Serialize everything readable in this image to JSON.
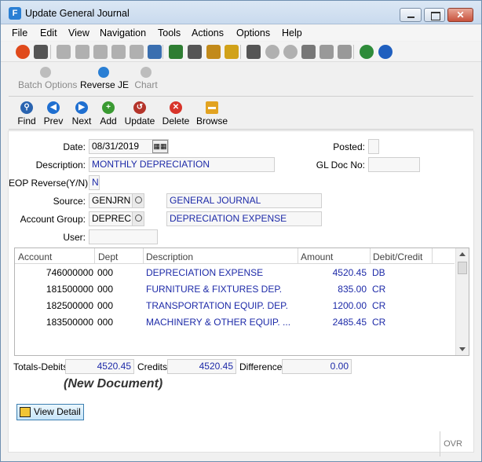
{
  "window": {
    "title": "Update General Journal"
  },
  "menu": [
    "File",
    "Edit",
    "View",
    "Navigation",
    "Tools",
    "Actions",
    "Options",
    "Help"
  ],
  "toolbar_icons": [
    {
      "name": "power-icon",
      "color": "#e04a1c"
    },
    {
      "name": "save-print-icon",
      "color": "#555555"
    },
    {
      "name": "check-icon",
      "color": "#b0b0b0"
    },
    {
      "name": "cancel-x-icon",
      "color": "#b0b0b0"
    },
    {
      "name": "copy-icon",
      "color": "#b0b0b0"
    },
    {
      "name": "paste-icon",
      "color": "#b0b0b0"
    },
    {
      "name": "select-icon",
      "color": "#b0b0b0"
    },
    {
      "name": "find-icon",
      "color": "#3a6fb0"
    },
    {
      "name": "notepad-icon",
      "color": "#2e7d32"
    },
    {
      "name": "document-icon",
      "color": "#555555"
    },
    {
      "name": "attach-icon",
      "color": "#c28a1a"
    },
    {
      "name": "calendar-icon",
      "color": "#d1a219"
    },
    {
      "name": "upload-icon",
      "color": "#555555"
    },
    {
      "name": "down-circle-icon",
      "color": "#b0b0b0"
    },
    {
      "name": "up-circle-icon",
      "color": "#b0b0b0"
    },
    {
      "name": "shuffle-icon",
      "color": "#777777"
    },
    {
      "name": "export-icon",
      "color": "#999999"
    },
    {
      "name": "delete-doc-icon",
      "color": "#999999"
    },
    {
      "name": "chart-trend-icon",
      "color": "#2e8b3a"
    },
    {
      "name": "help-icon",
      "color": "#1f5fbf"
    }
  ],
  "toolbar2": [
    {
      "label": "Batch Options",
      "enabled": false
    },
    {
      "label": "Reverse JE",
      "enabled": true
    },
    {
      "label": "Chart",
      "enabled": false
    }
  ],
  "toolbar3": [
    {
      "label": "Find",
      "color": "#2a64b0",
      "glyph": "⚲"
    },
    {
      "label": "Prev",
      "color": "#1f6fd0",
      "glyph": "◀"
    },
    {
      "label": "Next",
      "color": "#1f6fd0",
      "glyph": "▶"
    },
    {
      "label": "Add",
      "color": "#3a9a32",
      "glyph": "+"
    },
    {
      "label": "Update",
      "color": "#b4342a",
      "glyph": "↺"
    },
    {
      "label": "Delete",
      "color": "#d8342a",
      "glyph": "✕"
    },
    {
      "label": "Browse",
      "color": "#e2a321",
      "glyph": "▬"
    }
  ],
  "form": {
    "date_label": "Date:",
    "date_value": "08/31/2019",
    "posted_label": "Posted:",
    "posted_value": "",
    "description_label": "Description:",
    "description_value": "MONTHLY DEPRECIATION",
    "gl_doc_label": "GL Doc No:",
    "gl_doc_value": "",
    "eop_label": "EOP Reverse(Y/N):",
    "eop_value": "N",
    "source_label": "Source:",
    "source_code": "GENJRN",
    "source_desc": "GENERAL JOURNAL",
    "account_group_label": "Account Group:",
    "account_group_code": "DEPREC",
    "account_group_desc": "DEPRECIATION EXPENSE",
    "user_label": "User:",
    "user_value": ""
  },
  "grid": {
    "columns": [
      "Account",
      "Dept",
      "Description",
      "Amount",
      "Debit/Credit"
    ],
    "rows": [
      {
        "account": "746000000",
        "dept": "000",
        "description": "DEPRECIATION EXPENSE",
        "amount": "4520.45",
        "dc": "DB"
      },
      {
        "account": "181500000",
        "dept": "000",
        "description": "FURNITURE & FIXTURES DEP.",
        "amount": "835.00",
        "dc": "CR"
      },
      {
        "account": "182500000",
        "dept": "000",
        "description": "TRANSPORTATION EQUIP. DEP.",
        "amount": "1200.00",
        "dc": "CR"
      },
      {
        "account": "183500000",
        "dept": "000",
        "description": "MACHINERY & OTHER EQUIP. ...",
        "amount": "2485.45",
        "dc": "CR"
      }
    ]
  },
  "totals": {
    "debits_label": "Totals-Debits",
    "debits_value": "4520.45",
    "credits_label": "Credits",
    "credits_value": "4520.45",
    "difference_label": "Difference",
    "difference_value": "0.00"
  },
  "new_document": "(New Document)",
  "view_detail_label": "View Detail",
  "status": {
    "ovr": "OVR"
  }
}
